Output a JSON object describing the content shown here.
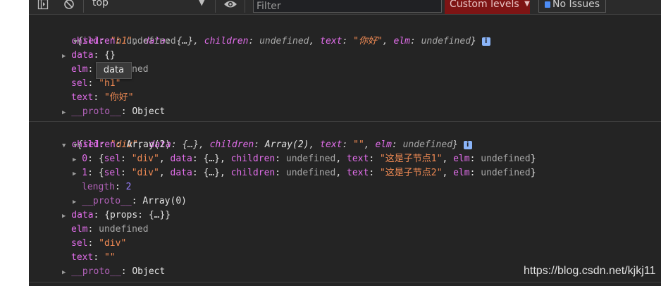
{
  "toolbar": {
    "context": "top",
    "filter_placeholder": "Filter",
    "levels_label": "Custom levels",
    "issues_label": "No Issues"
  },
  "entry1": {
    "summary_open": "{",
    "summary_sel_key": "sel",
    "summary_sel_val": "\"h1\"",
    "summary_data_key": "data",
    "summary_data_val": "{…}",
    "summary_children_key": "children",
    "summary_children_val": "undefined",
    "summary_text_key": "text",
    "summary_text_val": "\"你好\"",
    "summary_elm_key": "elm",
    "summary_elm_val": "undefined",
    "summary_close": "}",
    "children_key": "children",
    "children_val": "undefined",
    "data_key": "data",
    "data_val": "{}",
    "elm_key": "elm",
    "elm_val": "undefined",
    "sel_key": "sel",
    "sel_val": "\"h1\"",
    "text_key": "text",
    "text_val": "\"你好\"",
    "proto_key": "__proto__",
    "proto_val": "Object"
  },
  "tooltip": "data",
  "entry2": {
    "summary_sel_val": "\"div\"",
    "summary_children_val": "Array(2)",
    "summary_text_val": "\"\"",
    "summary_elm_val": "undefined",
    "children_key": "children",
    "children_val": "Array(2)",
    "items": [
      {
        "index": "0",
        "text_val": "\"这是子节点1\""
      },
      {
        "index": "1",
        "text_val": "\"这是子节点2\""
      }
    ],
    "item_sel_val": "\"div\"",
    "item_data_val": "{…}",
    "item_children_val": "undefined",
    "item_elm_val": "undefined",
    "length_key": "length",
    "length_val": "2",
    "array_proto_key": "__proto__",
    "array_proto_val": "Array(0)",
    "data_key": "data",
    "data_val": "{props: {…}}",
    "elm_key": "elm",
    "elm_val": "undefined",
    "sel_key": "sel",
    "sel_val": "\"div\"",
    "text_key": "text",
    "text_val": "\"\"",
    "proto_key": "__proto__",
    "proto_val": "Object"
  },
  "watermark": "https://blog.csdn.net/kjkj11"
}
